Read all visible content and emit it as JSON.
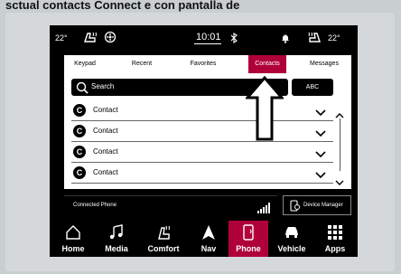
{
  "caption": "sctual contacts Connect e con pantalla de",
  "status": {
    "temp_left": "22°",
    "time": "10:01",
    "temp_right": "22°"
  },
  "tabs": [
    "Keypad",
    "Recent",
    "Favorites",
    "Contacts",
    "Messages"
  ],
  "active_tab": "Contacts",
  "search": {
    "label": "Search"
  },
  "abc_label": "ABC",
  "contacts": [
    {
      "initial": "C",
      "name": "Contact"
    },
    {
      "initial": "C",
      "name": "Contact"
    },
    {
      "initial": "C",
      "name": "Contact"
    },
    {
      "initial": "C",
      "name": "Contact"
    }
  ],
  "connected_phone_label": "Connected Phone",
  "device_manager_label": "Device Manager",
  "nav": [
    "Home",
    "Media",
    "Comfort",
    "Nav",
    "Phone",
    "Vehicle",
    "Apps"
  ],
  "active_nav": "Phone",
  "colors": {
    "accent": "#b0003a",
    "screen_bg": "#000000",
    "card_bg": "#ffffff"
  },
  "icons": [
    "heated-seat-icon",
    "bluetooth-icon",
    "bell-icon",
    "fan-icon",
    "home-icon",
    "media-note-icon",
    "comfort-seat-icon",
    "nav-arrow-icon",
    "phone-icon",
    "vehicle-icon",
    "apps-grid-icon",
    "signal-bars-icon",
    "device-manager-icon",
    "search-icon",
    "chevron-down-icon",
    "chevron-up-icon"
  ]
}
